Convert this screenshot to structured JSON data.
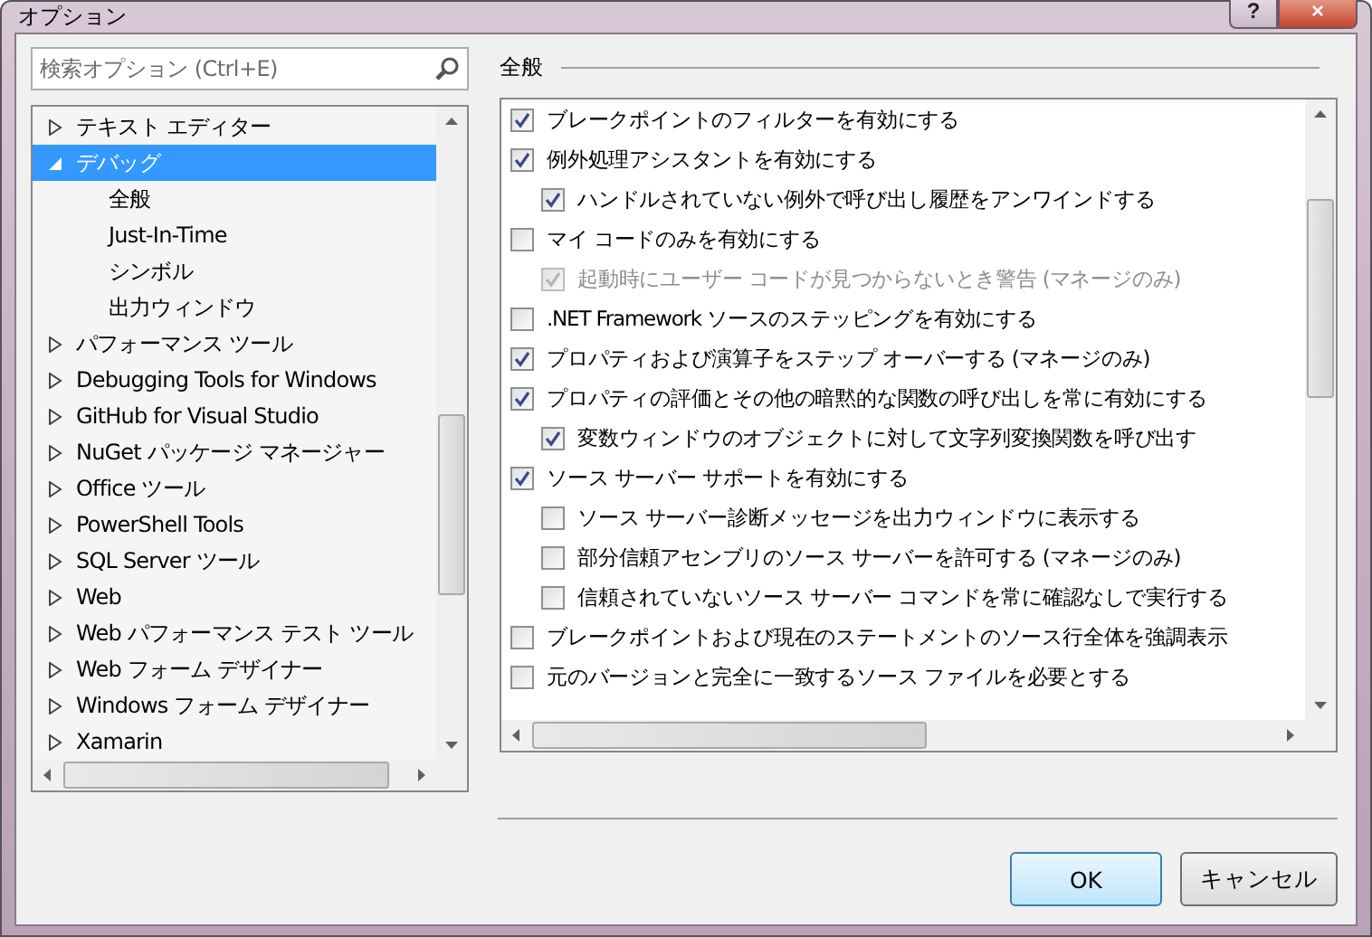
{
  "window": {
    "title": "オプション",
    "help_button": "?",
    "close_button": "×"
  },
  "search": {
    "placeholder": "検索オプション (Ctrl+E)"
  },
  "tree": [
    {
      "label": "テキスト エディター",
      "expanded": false,
      "selected": false
    },
    {
      "label": "デバッグ",
      "expanded": true,
      "selected": true,
      "children": [
        {
          "label": "全般",
          "selected": false
        },
        {
          "label": "Just-In-Time",
          "selected": false
        },
        {
          "label": "シンボル",
          "selected": false
        },
        {
          "label": "出力ウィンドウ",
          "selected": false
        }
      ]
    },
    {
      "label": "パフォーマンス ツール",
      "expanded": false,
      "selected": false
    },
    {
      "label": "Debugging Tools for Windows",
      "expanded": false,
      "selected": false
    },
    {
      "label": "GitHub for Visual Studio",
      "expanded": false,
      "selected": false
    },
    {
      "label": "NuGet パッケージ マネージャー",
      "expanded": false,
      "selected": false
    },
    {
      "label": "Office ツール",
      "expanded": false,
      "selected": false
    },
    {
      "label": "PowerShell Tools",
      "expanded": false,
      "selected": false
    },
    {
      "label": "SQL Server ツール",
      "expanded": false,
      "selected": false
    },
    {
      "label": "Web",
      "expanded": false,
      "selected": false
    },
    {
      "label": "Web パフォーマンス テスト ツール",
      "expanded": false,
      "selected": false
    },
    {
      "label": "Web フォーム デザイナー",
      "expanded": false,
      "selected": false
    },
    {
      "label": "Windows フォーム デザイナー",
      "expanded": false,
      "selected": false
    },
    {
      "label": "Xamarin",
      "expanded": false,
      "selected": false
    }
  ],
  "section_title": "全般",
  "options": [
    {
      "label": "ブレークポイントのフィルターを有効にする",
      "checked": true,
      "disabled": false
    },
    {
      "label": "例外処理アシスタントを有効にする",
      "checked": true,
      "disabled": false,
      "children": [
        {
          "label": "ハンドルされていない例外で呼び出し履歴をアンワインドする",
          "checked": true,
          "disabled": false
        }
      ]
    },
    {
      "label": "マイ コードのみを有効にする",
      "checked": false,
      "disabled": false,
      "children": [
        {
          "label": "起動時にユーザー コードが見つからないとき警告 (マネージのみ)",
          "checked": true,
          "disabled": true
        }
      ]
    },
    {
      "label": ".NET Framework ソースのステッピングを有効にする",
      "checked": false,
      "disabled": false
    },
    {
      "label": "プロパティおよび演算子をステップ オーバーする (マネージのみ)",
      "checked": true,
      "disabled": false
    },
    {
      "label": "プロパティの評価とその他の暗黙的な関数の呼び出しを常に有効にする",
      "checked": true,
      "disabled": false,
      "children": [
        {
          "label": "変数ウィンドウのオブジェクトに対して文字列変換関数を呼び出す",
          "checked": true,
          "disabled": false
        }
      ]
    },
    {
      "label": "ソース サーバー サポートを有効にする",
      "checked": true,
      "disabled": false,
      "children": [
        {
          "label": "ソース サーバー診断メッセージを出力ウィンドウに表示する",
          "checked": false,
          "disabled": false
        },
        {
          "label": "部分信頼アセンブリのソース サーバーを許可する (マネージのみ)",
          "checked": false,
          "disabled": false
        },
        {
          "label": "信頼されていないソース サーバー コマンドを常に確認なしで実行する",
          "checked": false,
          "disabled": false
        }
      ]
    },
    {
      "label": "ブレークポイントおよび現在のステートメントのソース行全体を強調表示",
      "checked": false,
      "disabled": false
    },
    {
      "label": "元のバージョンと完全に一致するソース ファイルを必要とする",
      "checked": false,
      "disabled": false
    }
  ],
  "buttons": [
    {
      "label": "OK",
      "default": true
    },
    {
      "label": "キャンセル",
      "default": false
    }
  ]
}
